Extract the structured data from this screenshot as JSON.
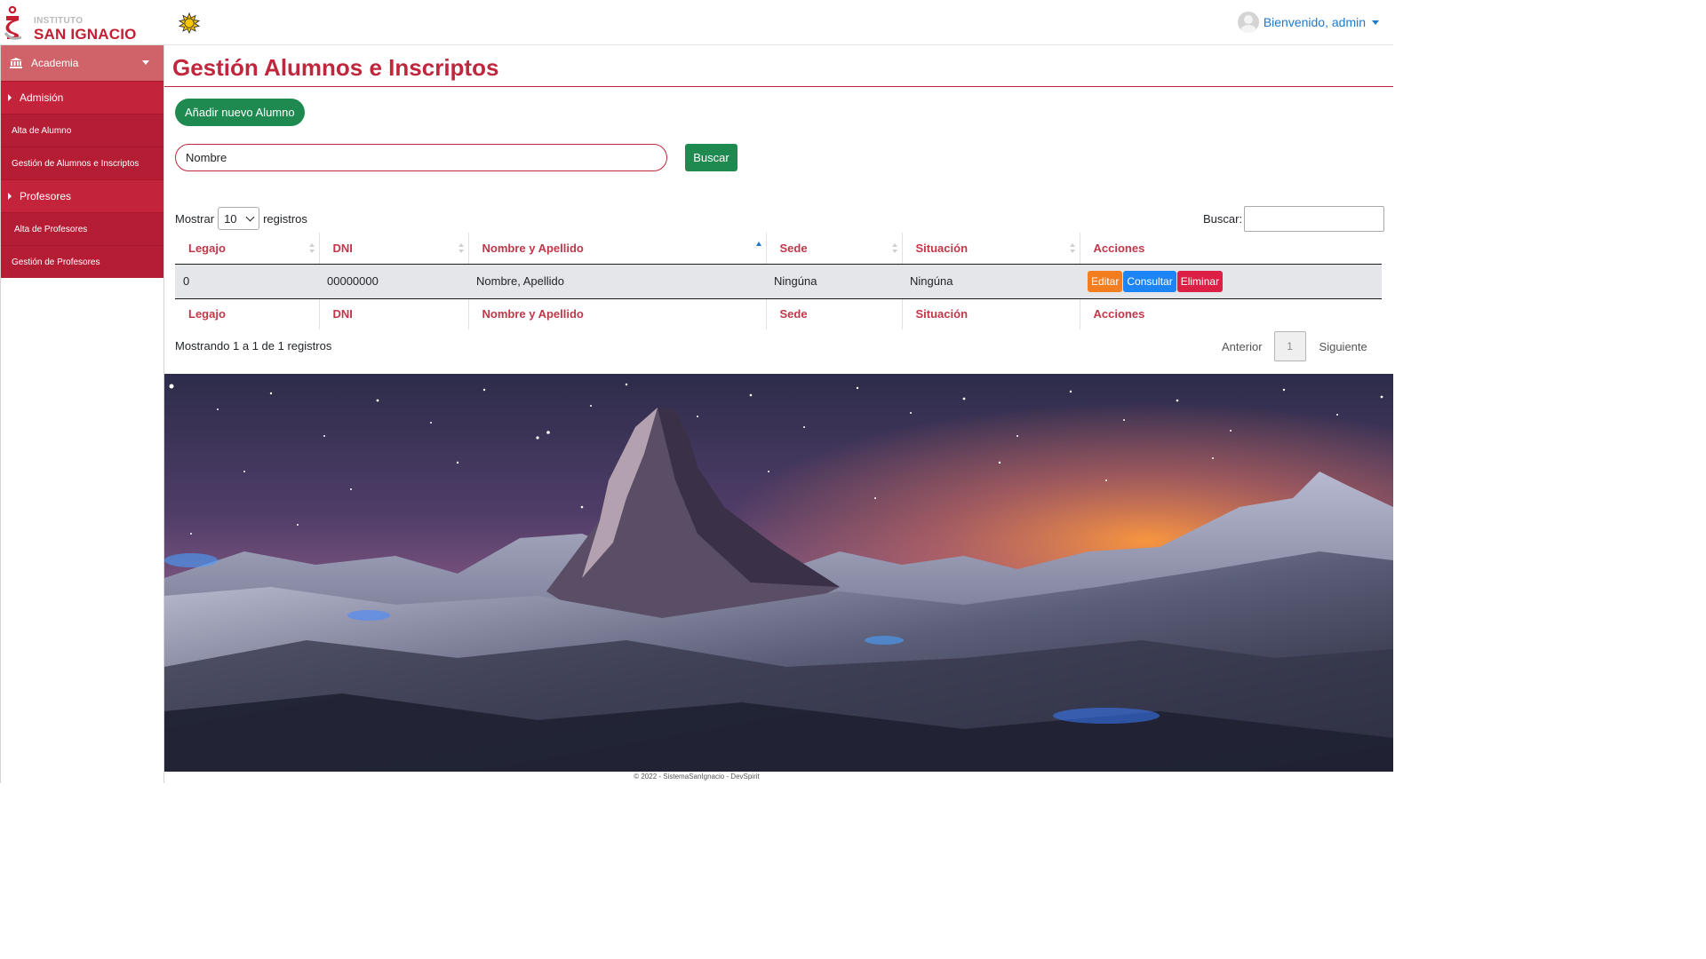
{
  "header": {
    "logo_small": "INSTITUTO",
    "logo_big": "SAN IGNACIO",
    "user_label": "Bienvenido, admin"
  },
  "sidebar": {
    "section": "Academia",
    "groups": [
      {
        "label": "Admisión",
        "items": [
          "Alta de Alumno",
          "Gestión de Alumnos e Inscriptos"
        ]
      },
      {
        "label": "Profesores",
        "items": [
          "Alta de Profesores",
          "Gestión de Profesores"
        ]
      }
    ]
  },
  "main": {
    "title": "Gestión Alumnos e Inscriptos",
    "add_button": "Añadir nuevo Alumno",
    "name_input_value": "Nombre",
    "search_button": "Buscar",
    "length_prefix": "Mostrar",
    "length_value": "10",
    "length_suffix": "registros",
    "filter_label": "Buscar:",
    "table": {
      "columns": [
        "Legajo",
        "DNI",
        "Nombre y Apellido",
        "Sede",
        "Situación",
        "Acciones"
      ],
      "rows": [
        {
          "legajo": "0",
          "dni": "00000000",
          "nombre": "Nombre, Apellido",
          "sede": "Ningúna",
          "situacion": "Ningúna"
        }
      ],
      "actions": [
        "Editar",
        "Consultar",
        "Eliminar"
      ]
    },
    "info": "Mostrando 1 a 1 de 1 registros",
    "pagination": {
      "previous": "Anterior",
      "page": "1",
      "next": "Siguiente"
    }
  },
  "footer": "© 2022 - SistemaSanIgnacio - DevSpirit",
  "icons": [
    "logo-mark-icon",
    "sun-icon",
    "avatar-icon",
    "caret-down-icon",
    "bank-icon",
    "chevron-down-icon",
    "caret-right-icon",
    "sort-icon",
    "sort-asc-icon",
    "select-arrow-icon"
  ],
  "colors": {
    "brand_red": "#c0263c",
    "sidebar_red": "#c4243b",
    "green": "#1f8a4f",
    "link_blue": "#1e79c9",
    "edit_orange": "#f47d1f",
    "view_blue": "#1d84f5",
    "delete_red": "#dc1f45"
  }
}
